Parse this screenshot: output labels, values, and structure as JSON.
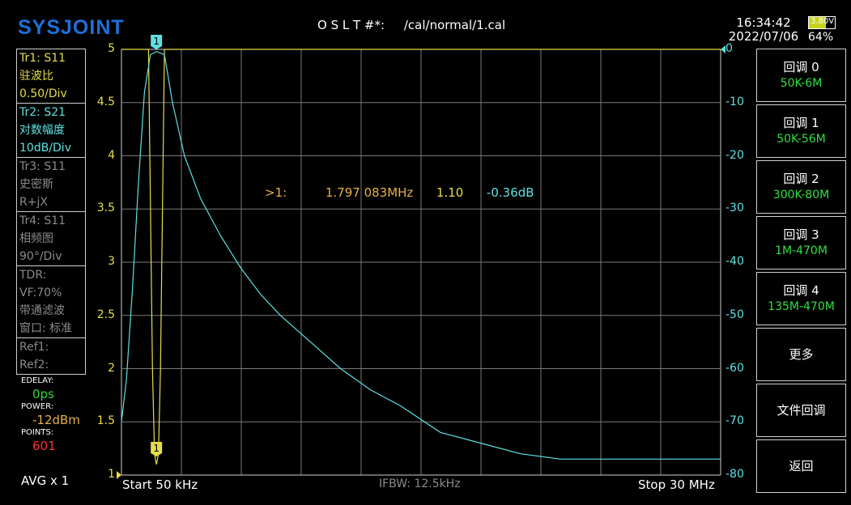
{
  "header": {
    "logo": "SYSJOINT",
    "cal_path": "O S L T #*:     /cal/normal/1.cal",
    "time": "16:34:42",
    "date": "2022/07/06",
    "battery_voltage": "3.80V",
    "battery_percent": "64%"
  },
  "traces": [
    {
      "line1": "Tr1:   S11",
      "line2": "驻波比",
      "line3": "0.50/Div",
      "color": "#e6dd4a"
    },
    {
      "line1": "Tr2:   S21",
      "line2": "对数幅度",
      "line3": "10dB/Div",
      "color": "#5ee0e0"
    },
    {
      "line1": "Tr3:   S11",
      "line2": "史密斯",
      "line3": "R+jX",
      "color": "#8a8a8a"
    },
    {
      "line1": "Tr4:   S11",
      "line2": "相频图",
      "line3": "90°/Div",
      "color": "#8a8a8a"
    }
  ],
  "tdr": {
    "line1": "TDR:",
    "line2": "VF:70%",
    "line3": "带通滤波",
    "line4": "窗口: 标准"
  },
  "refs": {
    "ref1": "Ref1:",
    "ref2": "Ref2:"
  },
  "status": {
    "edelay_label": "EDELAY:",
    "edelay_value": "0ps",
    "power_label": "POWER:",
    "power_value": "-12dBm",
    "points_label": "POINTS:",
    "points_value": "601",
    "avg": "AVG x 1"
  },
  "menu": [
    {
      "title": "回调 0",
      "sub": "50K-6M"
    },
    {
      "title": "回调 1",
      "sub": "50K-56M"
    },
    {
      "title": "回调 2",
      "sub": "300K-80M"
    },
    {
      "title": "回调 3",
      "sub": "1M-470M"
    },
    {
      "title": "回调 4",
      "sub": "135M-470M"
    },
    {
      "title": "更多",
      "sub": ""
    },
    {
      "title": "文件回调",
      "sub": ""
    },
    {
      "title": "返回",
      "sub": ""
    }
  ],
  "plot": {
    "start": "Start   50 kHz",
    "stop": "Stop   30 MHz",
    "ifbw": "IFBW: 12.5kHz",
    "marker_label": "1",
    "marker_readout": {
      "id": ">1:",
      "freq": "1.797 083MHz",
      "swr": "1.10",
      "db": "-0.36dB"
    }
  },
  "chart_data": {
    "type": "line",
    "x_start_khz": 50,
    "x_stop_mhz": 30,
    "grid": true,
    "series": [
      {
        "name": "Tr1: S11",
        "axis": "left",
        "color": "#e6dd4a",
        "x_mhz": [
          0.05,
          0.6,
          1.0,
          1.4,
          1.6,
          1.7,
          1.8,
          1.9,
          2.0,
          2.2,
          3.0,
          30
        ],
        "values": [
          5,
          5,
          5,
          5,
          2.0,
          1.2,
          1.1,
          1.2,
          2.0,
          5,
          5,
          5
        ]
      },
      {
        "name": "Tr2: S21",
        "axis": "right",
        "color": "#5ee0e0",
        "x_mhz": [
          0.05,
          0.3,
          0.6,
          0.9,
          1.2,
          1.5,
          1.8,
          2.2,
          2.6,
          3.2,
          4.0,
          5.0,
          6.0,
          7.0,
          8.0,
          9.5,
          11.0,
          12.5,
          14.0,
          16.0,
          18.0,
          20.0,
          22.0,
          24.0,
          26.0,
          28.0,
          30.0
        ],
        "values": [
          -70,
          -62,
          -45,
          -25,
          -8,
          -1,
          -0.4,
          -1,
          -10,
          -20,
          -28,
          -35,
          -41,
          -46,
          -50,
          -55,
          -60,
          -64,
          -67,
          -72,
          -74,
          -76,
          -77,
          -77,
          -77,
          -77,
          -77
        ]
      }
    ],
    "left_axis": {
      "ticks": [
        "5",
        "4.5",
        "4",
        "3.5",
        "3",
        "2.5",
        "2",
        "1.5",
        "1"
      ],
      "range": [
        1,
        5
      ]
    },
    "right_axis": {
      "ticks": [
        "0",
        "-10",
        "-20",
        "-30",
        "-40",
        "-50",
        "-60",
        "-70",
        "-80"
      ],
      "range": [
        -80,
        0
      ]
    }
  }
}
